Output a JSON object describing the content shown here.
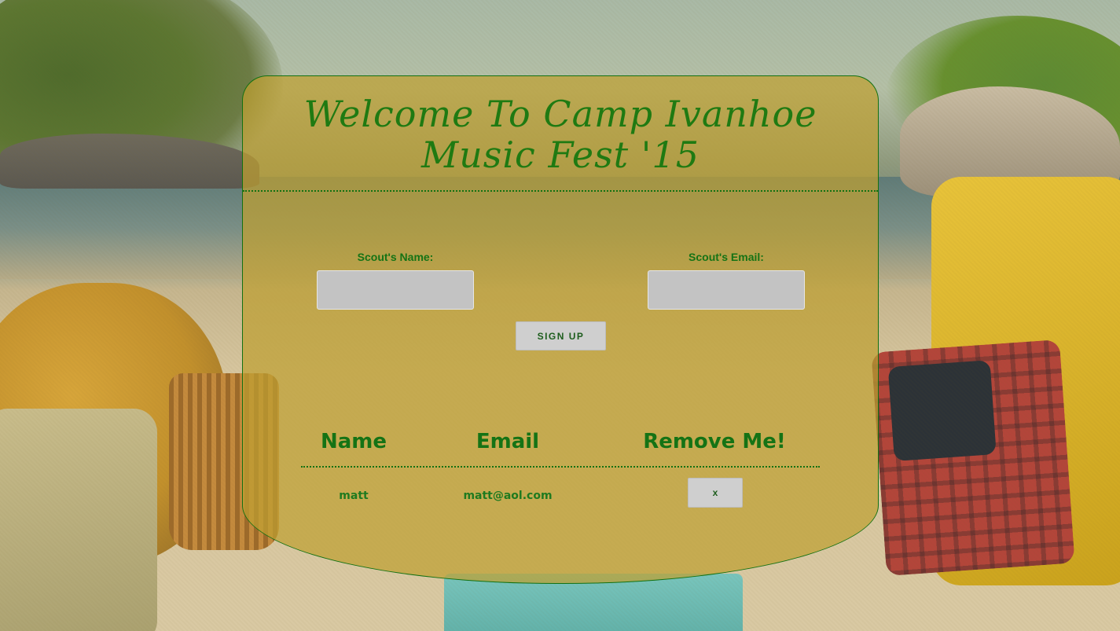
{
  "page": {
    "title_line1": "Welcome To Camp Ivanhoe",
    "title_line2": "Music Fest '15"
  },
  "form": {
    "name_label": "Scout's Name:",
    "name_value": "",
    "email_label": "Scout's Email:",
    "email_value": "",
    "signup_label": "SIGN UP"
  },
  "table": {
    "headers": [
      "Name",
      "Email",
      "Remove Me!"
    ],
    "rows": [
      {
        "name": "matt",
        "email": "matt@aol.com",
        "remove_label": "x"
      }
    ]
  },
  "colors": {
    "accent_green": "#157315",
    "panel_fill": "rgba(190,160,50,0.72)",
    "button_gray": "#cfcfcf",
    "input_gray": "#c3c3c3"
  }
}
